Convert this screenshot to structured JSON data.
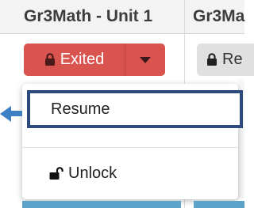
{
  "table": {
    "columns": [
      {
        "header": "Gr3Math - Unit 1"
      },
      {
        "header": "Gr3Ma"
      }
    ]
  },
  "status_button": {
    "label": "Exited",
    "color": "#d9534f",
    "icon": "lock-icon"
  },
  "second_button": {
    "label": "Re",
    "icon": "lock-icon"
  },
  "dropdown_menu": {
    "items": [
      {
        "label": "Resume",
        "highlighted": true
      },
      {
        "label": "Unlock",
        "icon": "unlock-icon"
      }
    ],
    "highlight_color": "#2c4a7c"
  }
}
